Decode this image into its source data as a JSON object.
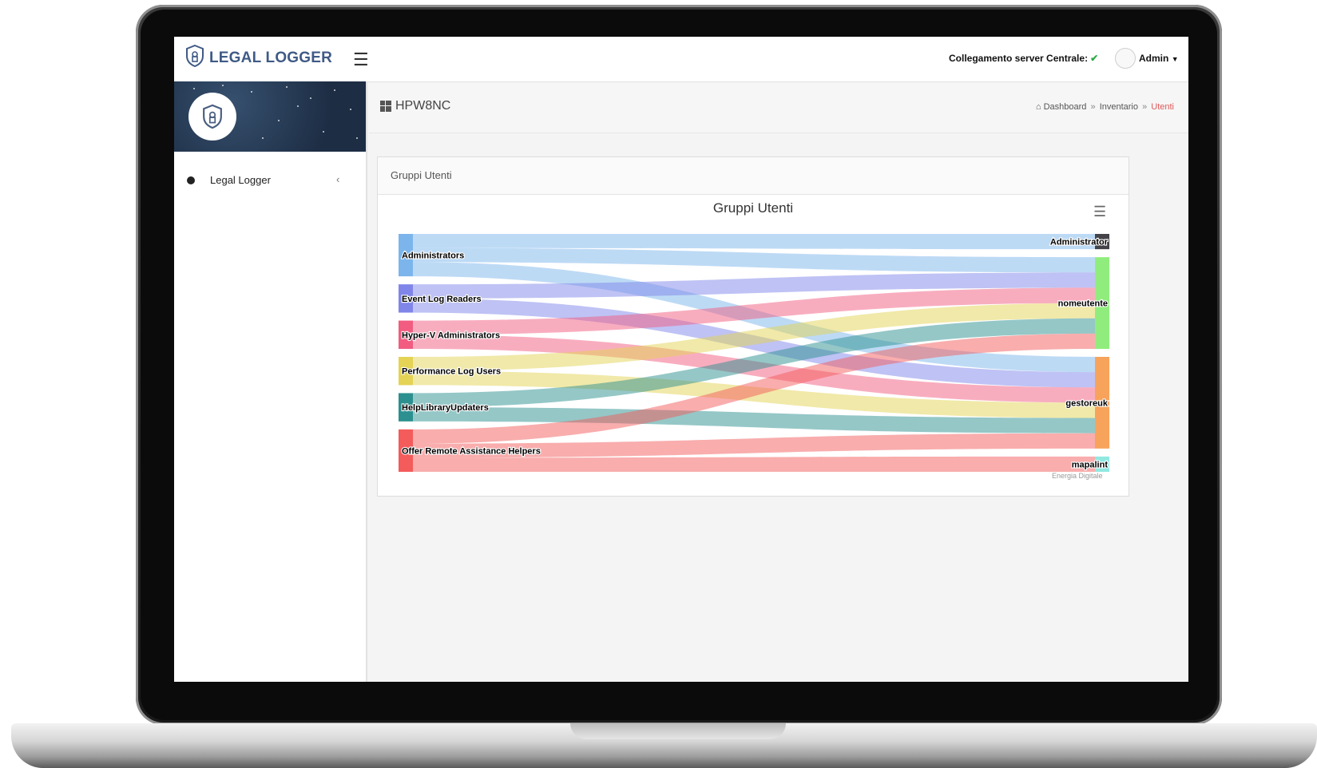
{
  "app": {
    "logo_text": "LEGAL LOGGER",
    "server_status": "Collegamento server Centrale:",
    "server_status_icon": "check-icon",
    "user_label": "Admin"
  },
  "sidebar": {
    "items": [
      {
        "label": "Legal Logger",
        "icon": "chevron-left-icon"
      }
    ]
  },
  "page": {
    "title": "HPW8NC",
    "title_icon": "windows-icon",
    "breadcrumb": [
      "Dashboard",
      "Inventario",
      "Utenti"
    ],
    "breadcrumb_icon": "home-icon"
  },
  "panel": {
    "heading": "Gruppi Utenti",
    "credits": "Energia Digitale"
  },
  "chart_data": {
    "type": "sankey",
    "title": "Gruppi Utenti",
    "sources": [
      {
        "name": "Administrators",
        "color": "#7cb5ec"
      },
      {
        "name": "Event Log Readers",
        "color": "#8085e9"
      },
      {
        "name": "Hyper-V Administrators",
        "color": "#f15c80"
      },
      {
        "name": "Performance Log Users",
        "color": "#e4d354"
      },
      {
        "name": "HelpLibraryUpdaters",
        "color": "#2b908f"
      },
      {
        "name": "Offer Remote Assistance Helpers",
        "color": "#f45b5b"
      }
    ],
    "targets": [
      {
        "name": "Administrator",
        "color": "#434348"
      },
      {
        "name": "nomeutente",
        "color": "#90ed7d"
      },
      {
        "name": "gestoreuk",
        "color": "#f7a35c"
      },
      {
        "name": "mapalint",
        "color": "#91e8e1"
      }
    ],
    "links": [
      {
        "from": "Administrators",
        "to": "Administrator",
        "weight": 1
      },
      {
        "from": "Administrators",
        "to": "nomeutente",
        "weight": 1
      },
      {
        "from": "Administrators",
        "to": "gestoreuk",
        "weight": 1
      },
      {
        "from": "Event Log Readers",
        "to": "nomeutente",
        "weight": 1
      },
      {
        "from": "Event Log Readers",
        "to": "gestoreuk",
        "weight": 1
      },
      {
        "from": "Hyper-V Administrators",
        "to": "nomeutente",
        "weight": 1
      },
      {
        "from": "Hyper-V Administrators",
        "to": "gestoreuk",
        "weight": 1
      },
      {
        "from": "Performance Log Users",
        "to": "nomeutente",
        "weight": 1
      },
      {
        "from": "Performance Log Users",
        "to": "gestoreuk",
        "weight": 1
      },
      {
        "from": "HelpLibraryUpdaters",
        "to": "nomeutente",
        "weight": 1
      },
      {
        "from": "HelpLibraryUpdaters",
        "to": "gestoreuk",
        "weight": 1
      },
      {
        "from": "Offer Remote Assistance Helpers",
        "to": "nomeutente",
        "weight": 1
      },
      {
        "from": "Offer Remote Assistance Helpers",
        "to": "gestoreuk",
        "weight": 1
      },
      {
        "from": "Offer Remote Assistance Helpers",
        "to": "mapalint",
        "weight": 1
      }
    ]
  }
}
